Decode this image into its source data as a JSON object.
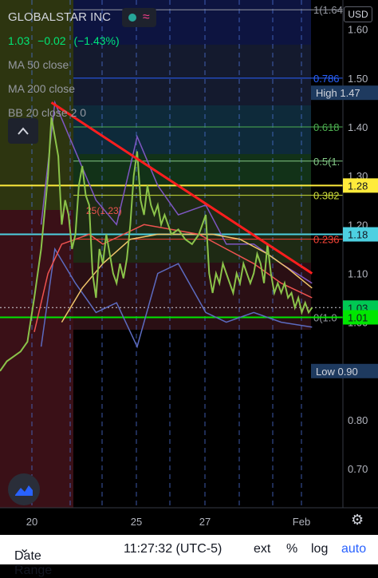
{
  "chart_data": {
    "type": "line",
    "symbol": "GLOBALSTAR INC",
    "quote": {
      "last": "1.03",
      "change": "−0.02",
      "change_pct": "(−1.43%)"
    },
    "indicators": [
      "MA 50 close",
      "MA 200 close",
      "BB 20 close 2 0"
    ],
    "currency": "USD",
    "y_axis": {
      "min": 0.62,
      "max": 1.66,
      "ticks": [
        0.7,
        0.8,
        0.9,
        1.0,
        1.1,
        1.2,
        1.3,
        1.4,
        1.5,
        1.6
      ],
      "tick_labels": [
        "0.70",
        "0.80",
        "0.90",
        "1.00",
        "1.10",
        "1.20",
        "1.30",
        "1.40",
        "1.50",
        "1.60"
      ]
    },
    "x_axis": {
      "labels": [
        {
          "label": "20",
          "pos": 40
        },
        {
          "label": "25",
          "pos": 171
        },
        {
          "label": "27",
          "pos": 257
        },
        {
          "label": "Feb",
          "pos": 378
        }
      ]
    },
    "fib_levels": [
      {
        "label": "1(1.64",
        "value": 1.64,
        "color": "#9598a1"
      },
      {
        "label": "0.786",
        "value": 1.5,
        "color": "#2962ff"
      },
      {
        "label": "0.618",
        "value": 1.4,
        "color": "#4caf50"
      },
      {
        "label": "0.5(1.",
        "value": 1.33,
        "color": "#81c784"
      },
      {
        "label": "0.382",
        "value": 1.26,
        "color": "#cddc39"
      },
      {
        "label": "0.236",
        "value": 1.17,
        "color": "#f44336"
      },
      {
        "label": "0(1.0",
        "value": 1.01,
        "color": "#9598a1"
      }
    ],
    "fib_mid_label": "25(1.23)",
    "price_labels": [
      {
        "text": "High",
        "value": "1.47",
        "y": 1.47,
        "bg": "#1e3a5f",
        "fg": "#d1d4dc"
      },
      {
        "text": "",
        "value": "1.28",
        "y": 1.28,
        "bg": "#ffeb3b",
        "fg": "#131722"
      },
      {
        "text": "",
        "value": "1.18",
        "y": 1.18,
        "bg": "#4dd0e1",
        "fg": "#131722"
      },
      {
        "text": "",
        "value": "1.03",
        "y": 1.03,
        "bg": "#00c853",
        "fg": "#131722"
      },
      {
        "text": "",
        "value": "1.01",
        "y": 1.01,
        "bg": "#00e600",
        "fg": "#131722"
      },
      {
        "text": "Low",
        "value": "0.90",
        "y": 0.9,
        "bg": "#1e3a5f",
        "fg": "#d1d4dc"
      }
    ],
    "horizontal_lines": [
      {
        "value": 1.28,
        "color": "#ffeb3b"
      },
      {
        "value": 1.18,
        "color": "#4dd0e1"
      },
      {
        "value": 1.01,
        "color": "#00e600"
      }
    ],
    "trendline": {
      "from": [
        0.15,
        1.45
      ],
      "to": [
        0.91,
        1.1
      ],
      "color": "#ff1e1e"
    },
    "price_series": [
      [
        0.0,
        0.9
      ],
      [
        0.02,
        0.92
      ],
      [
        0.04,
        0.93
      ],
      [
        0.06,
        0.94
      ],
      [
        0.08,
        0.96
      ],
      [
        0.1,
        1.05
      ],
      [
        0.12,
        1.15
      ],
      [
        0.14,
        1.3
      ],
      [
        0.15,
        1.42
      ],
      [
        0.16,
        1.38
      ],
      [
        0.17,
        1.34
      ],
      [
        0.18,
        1.2
      ],
      [
        0.19,
        1.25
      ],
      [
        0.2,
        1.22
      ],
      [
        0.21,
        1.15
      ],
      [
        0.22,
        1.18
      ],
      [
        0.23,
        1.28
      ],
      [
        0.24,
        1.32
      ],
      [
        0.25,
        1.26
      ],
      [
        0.26,
        1.24
      ],
      [
        0.27,
        1.1
      ],
      [
        0.28,
        1.05
      ],
      [
        0.29,
        1.15
      ],
      [
        0.3,
        1.12
      ],
      [
        0.31,
        1.18
      ],
      [
        0.32,
        1.14
      ],
      [
        0.33,
        1.1
      ],
      [
        0.34,
        1.08
      ],
      [
        0.35,
        1.12
      ],
      [
        0.36,
        1.09
      ],
      [
        0.37,
        1.13
      ],
      [
        0.38,
        1.2
      ],
      [
        0.39,
        1.3
      ],
      [
        0.4,
        1.35
      ],
      [
        0.41,
        1.25
      ],
      [
        0.42,
        1.22
      ],
      [
        0.43,
        1.28
      ],
      [
        0.44,
        1.24
      ],
      [
        0.45,
        1.22
      ],
      [
        0.46,
        1.24
      ],
      [
        0.47,
        1.2
      ],
      [
        0.48,
        1.22
      ],
      [
        0.49,
        1.2
      ],
      [
        0.5,
        1.18
      ],
      [
        0.52,
        1.19
      ],
      [
        0.54,
        1.17
      ],
      [
        0.56,
        1.16
      ],
      [
        0.58,
        1.18
      ],
      [
        0.6,
        1.22
      ],
      [
        0.61,
        1.1
      ],
      [
        0.62,
        1.06
      ],
      [
        0.63,
        1.1
      ],
      [
        0.64,
        1.08
      ],
      [
        0.65,
        1.12
      ],
      [
        0.66,
        1.1
      ],
      [
        0.67,
        1.08
      ],
      [
        0.68,
        1.06
      ],
      [
        0.69,
        1.1
      ],
      [
        0.7,
        1.08
      ],
      [
        0.71,
        1.12
      ],
      [
        0.72,
        1.1
      ],
      [
        0.73,
        1.08
      ],
      [
        0.74,
        1.1
      ],
      [
        0.75,
        1.14
      ],
      [
        0.76,
        1.12
      ],
      [
        0.77,
        1.08
      ],
      [
        0.78,
        1.16
      ],
      [
        0.79,
        1.1
      ],
      [
        0.8,
        1.06
      ],
      [
        0.81,
        1.08
      ],
      [
        0.82,
        1.06
      ],
      [
        0.83,
        1.08
      ],
      [
        0.84,
        1.05
      ],
      [
        0.85,
        1.06
      ],
      [
        0.86,
        1.03
      ],
      [
        0.87,
        1.05
      ],
      [
        0.88,
        1.02
      ],
      [
        0.89,
        1.04
      ],
      [
        0.9,
        1.02
      ],
      [
        0.91,
        1.03
      ]
    ],
    "ma50": [
      [
        0.1,
        0.98
      ],
      [
        0.14,
        1.1
      ],
      [
        0.18,
        1.16
      ],
      [
        0.22,
        1.17
      ],
      [
        0.26,
        1.18
      ],
      [
        0.3,
        1.16
      ],
      [
        0.36,
        1.18
      ],
      [
        0.42,
        1.2
      ],
      [
        0.5,
        1.19
      ],
      [
        0.58,
        1.18
      ],
      [
        0.66,
        1.15
      ],
      [
        0.74,
        1.12
      ],
      [
        0.82,
        1.08
      ],
      [
        0.91,
        1.05
      ]
    ],
    "ma200": [
      [
        0.18,
        1.0
      ],
      [
        0.24,
        1.07
      ],
      [
        0.3,
        1.12
      ],
      [
        0.38,
        1.17
      ],
      [
        0.46,
        1.18
      ],
      [
        0.54,
        1.18
      ],
      [
        0.62,
        1.18
      ],
      [
        0.7,
        1.17
      ],
      [
        0.78,
        1.14
      ],
      [
        0.84,
        1.11
      ],
      [
        0.91,
        1.07
      ]
    ],
    "bb_upper": [
      [
        0.12,
        1.2
      ],
      [
        0.16,
        1.45
      ],
      [
        0.22,
        1.35
      ],
      [
        0.28,
        1.25
      ],
      [
        0.34,
        1.2
      ],
      [
        0.4,
        1.38
      ],
      [
        0.46,
        1.28
      ],
      [
        0.52,
        1.22
      ],
      [
        0.6,
        1.24
      ],
      [
        0.66,
        1.16
      ],
      [
        0.74,
        1.16
      ],
      [
        0.82,
        1.12
      ],
      [
        0.91,
        1.08
      ]
    ],
    "bb_lower": [
      [
        0.12,
        0.95
      ],
      [
        0.16,
        1.15
      ],
      [
        0.22,
        1.08
      ],
      [
        0.28,
        1.02
      ],
      [
        0.34,
        1.04
      ],
      [
        0.4,
        0.95
      ],
      [
        0.46,
        1.1
      ],
      [
        0.52,
        1.12
      ],
      [
        0.6,
        1.02
      ],
      [
        0.66,
        1.0
      ],
      [
        0.74,
        1.02
      ],
      [
        0.82,
        1.0
      ],
      [
        0.91,
        0.99
      ]
    ],
    "grid": true
  },
  "ui": {
    "legend": {
      "title": "GLOBALSTAR INC",
      "wave_icon": "≈"
    },
    "bottom_bar": {
      "date_range": "Date Range",
      "chevron": "⌄",
      "time": "11:27:32 (UTC-5)",
      "ext": "ext",
      "percent": "%",
      "log": "log",
      "auto": "auto"
    },
    "icons": {
      "collapse": "chevron-up-icon",
      "gear": "gear-icon",
      "logo": "tradingview-logo"
    }
  }
}
